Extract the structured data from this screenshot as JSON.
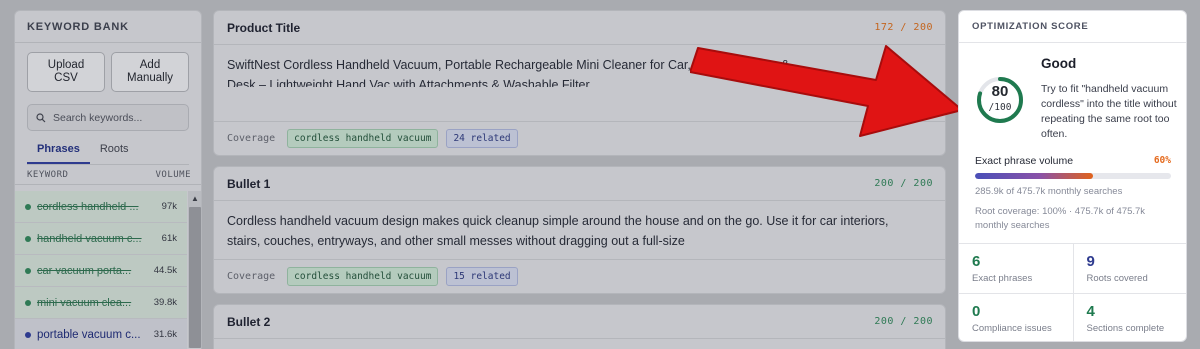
{
  "keyword_bank": {
    "title": "KEYWORD BANK",
    "upload_label": "Upload\nCSV",
    "add_label": "Add\nManually",
    "search_placeholder": "Search keywords...",
    "tabs": [
      "Phrases",
      "Roots"
    ],
    "active_tab": "Phrases",
    "col_keyword": "KEYWORD",
    "col_volume": "VOLUME",
    "keywords": [
      {
        "text": "cordless handheld ...",
        "volume": "97k",
        "status": "done"
      },
      {
        "text": "handheld vacuum c...",
        "volume": "61k",
        "status": "done"
      },
      {
        "text": "car vacuum porta...",
        "volume": "44.5k",
        "status": "done"
      },
      {
        "text": "mini vacuum clea...",
        "volume": "39.8k",
        "status": "done"
      },
      {
        "text": "portable vacuum c...",
        "volume": "31.6k",
        "status": "active"
      }
    ],
    "colors": {
      "done": "#2f7a55",
      "active": "#2e3b8f"
    }
  },
  "sections": [
    {
      "title": "Product Title",
      "count": "172 / 200",
      "count_color": "#c4651e",
      "text": "SwiftNest Cordless Handheld Vacuum, Portable Rechargeable Mini Cleaner for Car, Pet Hair, Stairs & Desk – Lightweight Hand Vac with Attachments & Washable Filter",
      "coverage_label": "Coverage",
      "chip_main": "cordless handheld vacuum",
      "chip_related": "24 related"
    },
    {
      "title": "Bullet 1",
      "count": "200 / 200",
      "count_color": "#2f7a55",
      "text": "Cordless handheld vacuum design makes quick cleanup simple around the house and on the go. Use it for car interiors, stairs, couches, entryways, and other small messes without dragging out a full-size",
      "coverage_label": "Coverage",
      "chip_main": "cordless handheld vacuum",
      "chip_related": "15 related"
    },
    {
      "title": "Bullet 2",
      "count": "200 / 200",
      "count_color": "#2f7a55"
    }
  ],
  "score_panel": {
    "title": "OPTIMIZATION SCORE",
    "grade": "Good",
    "score": "80",
    "score_max": "/100",
    "score_value": 80,
    "ring_color": "#1f7a4f",
    "tip": "Try to fit \"handheld vacuum cordless\" into the title without repeating the same root too often.",
    "exact_phrase_label": "Exact phrase volume",
    "exact_phrase_pct": "60%",
    "exact_phrase_value": 60,
    "monthly_line": "285.9k of 475.7k monthly searches",
    "root_line": "Root coverage: 100% · 475.7k of 475.7k monthly searches",
    "stats": [
      {
        "value": "6",
        "label": "Exact phrases",
        "color": "#1f7a4f"
      },
      {
        "value": "9",
        "label": "Roots covered",
        "color": "#2e3b8f"
      },
      {
        "value": "0",
        "label": "Compliance issues",
        "color": "#1f7a4f"
      },
      {
        "value": "4",
        "label": "Sections complete",
        "color": "#1f7a4f"
      }
    ]
  }
}
